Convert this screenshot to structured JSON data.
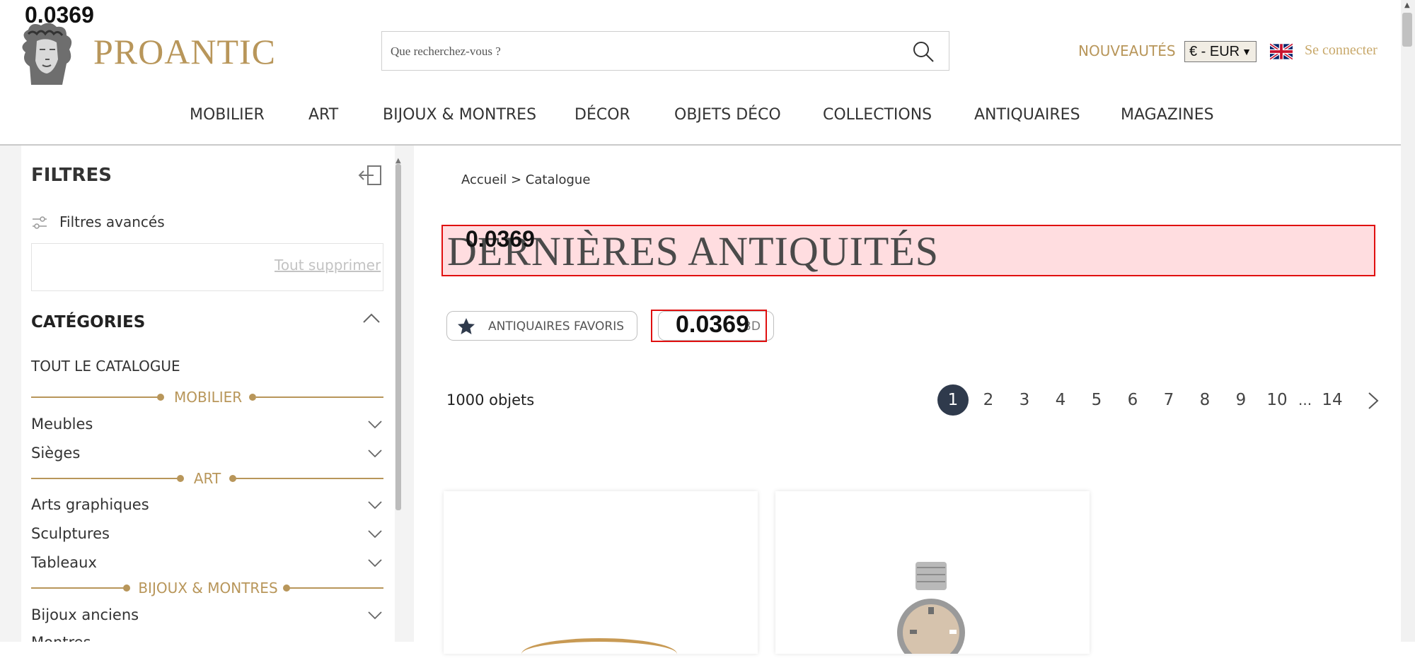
{
  "overlay": {
    "score_top": "0.0369",
    "score_title": "0.0369",
    "score_button": "0.0369"
  },
  "header": {
    "logo_text": "PROANTIC",
    "search_placeholder": "Que recherchez-vous ?",
    "nouveautes": "NOUVEAUTÉS",
    "currency": "€ - EUR",
    "language_flag": "uk-flag-icon",
    "signin": "Se connecter"
  },
  "nav": [
    "MOBILIER",
    "ART",
    "BIJOUX & MONTRES",
    "DÉCOR",
    "OBJETS DÉCO",
    "COLLECTIONS",
    "ANTIQUAIRES",
    "MAGAZINES"
  ],
  "sidebar": {
    "title": "FILTRES",
    "advanced": "Filtres avancés",
    "clear_all": "Tout supprimer",
    "categories_title": "CATÉGORIES",
    "all_catalog": "TOUT LE CATALOGUE",
    "groups": [
      "MOBILIER",
      "ART",
      "BIJOUX & MONTRES"
    ],
    "items": [
      "Meubles",
      "Sièges",
      "Arts graphiques",
      "Sculptures",
      "Tableaux",
      "Bijoux anciens",
      "Montres"
    ]
  },
  "main": {
    "breadcrumb": "Accueil > Catalogue",
    "title": "DERNIÈRES ANTIQUITÉS",
    "fav_button": "ANTIQUAIRES FAVORIS",
    "second_button_tail": "3D",
    "count": "1000 objets",
    "pages": [
      "1",
      "2",
      "3",
      "4",
      "5",
      "6",
      "7",
      "8",
      "9",
      "10",
      "14"
    ],
    "current_page": "1",
    "ellipsis": "..."
  },
  "colors": {
    "gold": "#b8965a",
    "dark": "#2f3a4c",
    "highlight": "#e01010"
  }
}
